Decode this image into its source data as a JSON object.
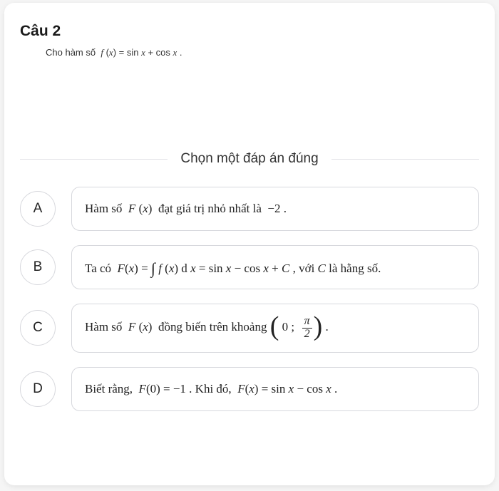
{
  "question": {
    "label": "Câu 2",
    "text": "Cho hàm số  f(x) = sin x + cos x ."
  },
  "prompt": "Chọn một đáp án đúng",
  "options": [
    {
      "letter": "A",
      "pre": "Hàm số  ",
      "mid": "F(x)",
      "post": "  đạt giá trị nhỏ nhất là  −2 ."
    },
    {
      "letter": "B",
      "text": "Ta có  F(x) = ∫ f(x) d x = sin x − cos x + C , với C là hằng số."
    },
    {
      "letter": "C",
      "pre": "Hàm số  ",
      "mid": "F(x)",
      "post": "  đồng biến trên khoảng",
      "interval": {
        "open": "(",
        "a": "0",
        "b_num": "π",
        "b_den": "2",
        "close": ")"
      }
    },
    {
      "letter": "D",
      "text": "Biết rằng,  F(0) = −1 . Khi đó,  F(x) = sin x − cos x ."
    }
  ]
}
